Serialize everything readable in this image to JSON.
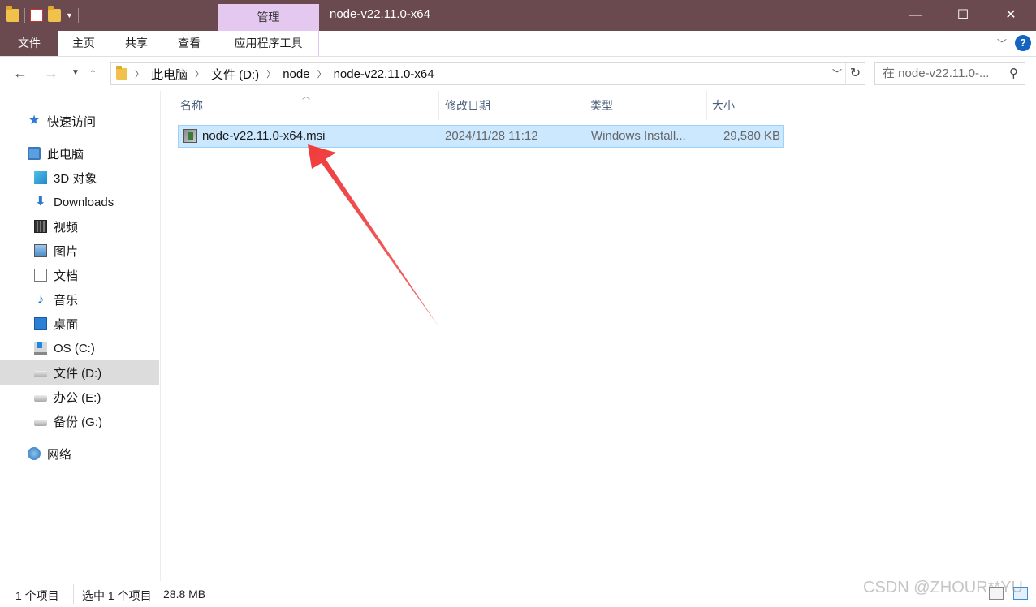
{
  "titlebar": {
    "context_tab": "管理",
    "title": "node-v22.11.0-x64",
    "controls": {
      "minimize": "—",
      "maximize": "☐",
      "close": "✕"
    }
  },
  "ribbon": {
    "tabs": [
      "文件",
      "主页",
      "共享",
      "查看",
      "应用程序工具"
    ],
    "help": "?"
  },
  "address": {
    "crumbs": [
      "此电脑",
      "文件 (D:)",
      "node",
      "node-v22.11.0-x64"
    ],
    "search_placeholder": "在 node-v22.11.0-..."
  },
  "sidebar": {
    "items": [
      {
        "label": "快速访问",
        "icon": "star-icon"
      },
      {
        "label": "此电脑",
        "icon": "computer-icon"
      },
      {
        "label": "3D 对象",
        "icon": "3d-objects-icon"
      },
      {
        "label": "Downloads",
        "icon": "download-arrow-icon"
      },
      {
        "label": "视频",
        "icon": "video-icon"
      },
      {
        "label": "图片",
        "icon": "picture-icon"
      },
      {
        "label": "文档",
        "icon": "document-icon"
      },
      {
        "label": "音乐",
        "icon": "music-note-icon"
      },
      {
        "label": "桌面",
        "icon": "desktop-icon"
      },
      {
        "label": "OS (C:)",
        "icon": "os-drive-icon"
      },
      {
        "label": "文件 (D:)",
        "icon": "drive-icon",
        "selected": true
      },
      {
        "label": "办公 (E:)",
        "icon": "drive-icon"
      },
      {
        "label": "备份 (G:)",
        "icon": "drive-icon"
      },
      {
        "label": "网络",
        "icon": "network-icon"
      }
    ]
  },
  "columns": [
    "名称",
    "修改日期",
    "类型",
    "大小"
  ],
  "files": [
    {
      "name": "node-v22.11.0-x64.msi",
      "modified": "2024/11/28 11:12",
      "type": "Windows Install...",
      "size": "29,580 KB",
      "icon": "msi-installer-icon",
      "selected": true
    }
  ],
  "status": {
    "count": "1 个项目",
    "selection": "选中 1 个项目",
    "size": "28.8 MB"
  },
  "watermark": "CSDN @ZHOUR**YU",
  "colors": {
    "titlebar": "#6b4a4f",
    "context_tab": "#e5c8f0",
    "selection": "#cce8ff",
    "annotation_arrow": "#f03c3c"
  }
}
